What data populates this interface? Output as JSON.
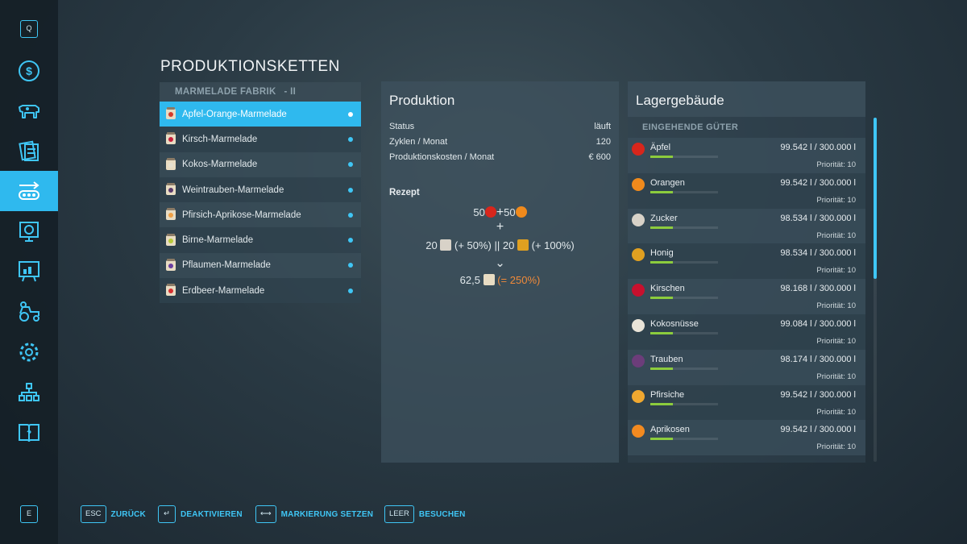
{
  "sidebar": {
    "top_key": "Q",
    "bottom_key": "E",
    "icons": [
      "dollar-icon",
      "cow-icon",
      "contracts-icon",
      "production-chains-icon",
      "statistics-icon",
      "chart-board-icon",
      "vehicles-icon",
      "settings-icon",
      "hierarchy-icon",
      "help-book-icon"
    ],
    "active_index": 3
  },
  "page_title": "PRODUKTIONSKETTEN",
  "production_list": {
    "header": "MARMELADE FABRIK",
    "header_suffix": "- II",
    "items": [
      {
        "label": "Apfel-Orange-Marmelade",
        "fruit_color": "#d43a2a",
        "selected": true
      },
      {
        "label": "Kirsch-Marmelade",
        "fruit_color": "#c81f3a"
      },
      {
        "label": "Kokos-Marmelade",
        "fruit_color": "#e6e0d0"
      },
      {
        "label": "Weintrauben-Marmelade",
        "fruit_color": "#5a3b6b"
      },
      {
        "label": "Pfirsich-Aprikose-Marmelade",
        "fruit_color": "#f0a045"
      },
      {
        "label": "Birne-Marmelade",
        "fruit_color": "#b8c93a"
      },
      {
        "label": "Pflaumen-Marmelade",
        "fruit_color": "#6a3ea0"
      },
      {
        "label": "Erdbeer-Marmelade",
        "fruit_color": "#d63030"
      }
    ]
  },
  "production": {
    "title": "Produktion",
    "rows": [
      {
        "label": "Status",
        "value": "läuft"
      },
      {
        "label": "Zyklen / Monat",
        "value": "120"
      },
      {
        "label": "Produktionskosten / Monat",
        "value": "€ 600"
      }
    ],
    "recipe_label": "Rezept",
    "recipe": {
      "input_a": "50",
      "plus_between": "+",
      "input_b": "50",
      "plus_line": "+",
      "boost_a": "20",
      "boost_a_pct": "(+ 50%)",
      "separator": "||",
      "boost_b": "20",
      "boost_b_pct": "(+ 100%)",
      "arrow": "⌄",
      "output": "62,5",
      "output_pct": "(= 250%)"
    }
  },
  "storage": {
    "title": "Lagergebäude",
    "sub_header": "EINGEHENDE GÜTER",
    "items": [
      {
        "name": "Äpfel",
        "amount": "99.542 l / 300.000 l",
        "priority": "Priorität: 10",
        "fill": 0.33,
        "icon": "apple-icon",
        "color": "#d8261c"
      },
      {
        "name": "Orangen",
        "amount": "99.542 l / 300.000 l",
        "priority": "Priorität: 10",
        "fill": 0.33,
        "icon": "orange-icon",
        "color": "#f08a1c"
      },
      {
        "name": "Zucker",
        "amount": "98.534 l / 300.000 l",
        "priority": "Priorität: 10",
        "fill": 0.33,
        "icon": "sugar-icon",
        "color": "#d8d2c8"
      },
      {
        "name": "Honig",
        "amount": "98.534 l / 300.000 l",
        "priority": "Priorität: 10",
        "fill": 0.33,
        "icon": "honey-icon",
        "color": "#e0a020"
      },
      {
        "name": "Kirschen",
        "amount": "98.168 l / 300.000 l",
        "priority": "Priorität: 10",
        "fill": 0.33,
        "icon": "cherries-icon",
        "color": "#c8102e"
      },
      {
        "name": "Kokosnüsse",
        "amount": "99.084 l / 300.000 l",
        "priority": "Priorität: 10",
        "fill": 0.33,
        "icon": "coconut-icon",
        "color": "#e9e4d8"
      },
      {
        "name": "Trauben",
        "amount": "98.174 l / 300.000 l",
        "priority": "Priorität: 10",
        "fill": 0.33,
        "icon": "grapes-icon",
        "color": "#6c3d7a"
      },
      {
        "name": "Pfirsiche",
        "amount": "99.542 l / 300.000 l",
        "priority": "Priorität: 10",
        "fill": 0.33,
        "icon": "peach-icon",
        "color": "#f0a830"
      },
      {
        "name": "Aprikosen",
        "amount": "99.542 l / 300.000 l",
        "priority": "Priorität: 10",
        "fill": 0.33,
        "icon": "apricot-icon",
        "color": "#f38a20"
      }
    ]
  },
  "bottom_bar": [
    {
      "key": "ESC",
      "label": "ZURÜCK"
    },
    {
      "key": "↵",
      "label": "DEAKTIVIEREN"
    },
    {
      "key": "⟷",
      "label": "MARKIERUNG SETZEN"
    },
    {
      "key": "LEER",
      "label": "BESUCHEN"
    }
  ],
  "colors": {
    "accent": "#2fb9ee",
    "bar_fill": "#8ccc3d",
    "highlight_orange": "#f08a3a"
  }
}
